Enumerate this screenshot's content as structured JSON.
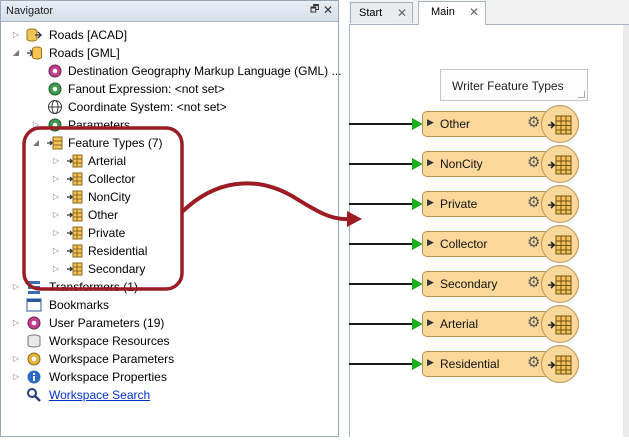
{
  "navigator": {
    "title": "Navigator",
    "restore_glyph": "🗗",
    "close_glyph": "✕",
    "items": [
      {
        "label": "Roads [ACAD]",
        "icon": "dataset-reader-icon"
      },
      {
        "label": "Roads [GML]",
        "icon": "dataset-writer-icon"
      },
      {
        "label": "Destination Geography Markup Language (GML) ...",
        "icon": "gear-icon"
      },
      {
        "label": "Fanout Expression: <not set>",
        "icon": "gear-icon"
      },
      {
        "label": "Coordinate System: <not set>",
        "icon": "globe-icon"
      },
      {
        "label": "Parameters",
        "icon": "gear-icon"
      },
      {
        "label": "Feature Types (7)",
        "icon": "feature-types-icon"
      },
      {
        "label": "Arterial",
        "icon": "feature-type-icon"
      },
      {
        "label": "Collector",
        "icon": "feature-type-icon"
      },
      {
        "label": "NonCity",
        "icon": "feature-type-icon"
      },
      {
        "label": "Other",
        "icon": "feature-type-icon"
      },
      {
        "label": "Private",
        "icon": "feature-type-icon"
      },
      {
        "label": "Residential",
        "icon": "feature-type-icon"
      },
      {
        "label": "Secondary",
        "icon": "feature-type-icon"
      },
      {
        "label": "Transformers (1)",
        "icon": "transformers-icon"
      },
      {
        "label": "Bookmarks",
        "icon": "bookmark-icon"
      },
      {
        "label": "User Parameters (19)",
        "icon": "user-parameters-icon"
      },
      {
        "label": "Workspace Resources",
        "icon": "resources-icon"
      },
      {
        "label": "Workspace Parameters",
        "icon": "workspace-parameters-icon"
      },
      {
        "label": "Workspace Properties",
        "icon": "info-icon"
      },
      {
        "label": "Workspace Search",
        "icon": "search-icon"
      }
    ]
  },
  "tabs": [
    {
      "label": "Start",
      "close": "✕",
      "active": false
    },
    {
      "label": "Main",
      "close": "✕",
      "active": true
    }
  ],
  "canvas": {
    "annotation": "Writer Feature Types",
    "writers": [
      "Other",
      "NonCity",
      "Private",
      "Collector",
      "Secondary",
      "Arterial",
      "Residential"
    ]
  },
  "colors": {
    "callout_stroke": "#9b1c24",
    "writer_fill": "#fbd89a",
    "writer_border": "#b7944e",
    "arrow_green": "#1cae1c",
    "link_blue": "#0033cc"
  }
}
